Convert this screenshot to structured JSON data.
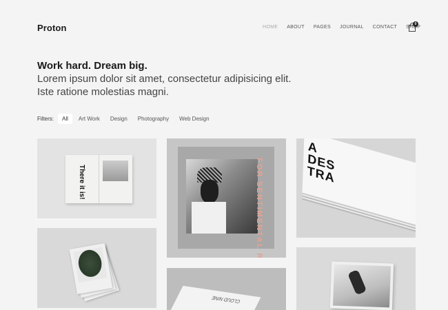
{
  "header": {
    "logo": "Proton",
    "nav": [
      "HOME",
      "ABOUT",
      "PAGES",
      "JOURNAL",
      "CONTACT",
      "SHOP"
    ],
    "active_nav": "HOME",
    "cart_count": "0"
  },
  "hero": {
    "title": "Work hard. Dream big.",
    "line1": "Lorem ipsum dolor sit amet, consectetur adipisicing elit.",
    "line2": "Iste ratione molestias magni."
  },
  "filters": {
    "label": "Filters:",
    "items": [
      "All",
      "Art Work",
      "Design",
      "Photography",
      "Web Design"
    ],
    "active": "All"
  },
  "portfolio": {
    "items": [
      {
        "name": "open-book",
        "text": "There it is!"
      },
      {
        "name": "magazine-stack",
        "text": ""
      },
      {
        "name": "poster",
        "text": "FOR SENTIMENTAL REASONS"
      },
      {
        "name": "card-stack",
        "text": "CLOUD NINE"
      },
      {
        "name": "business-cards",
        "lines": [
          "A",
          "DES",
          "TRA"
        ]
      },
      {
        "name": "photo-frame",
        "text": ""
      }
    ]
  },
  "colors": {
    "background": "#f4f4f4",
    "accent": "#e9a08e",
    "text": "#222222"
  }
}
